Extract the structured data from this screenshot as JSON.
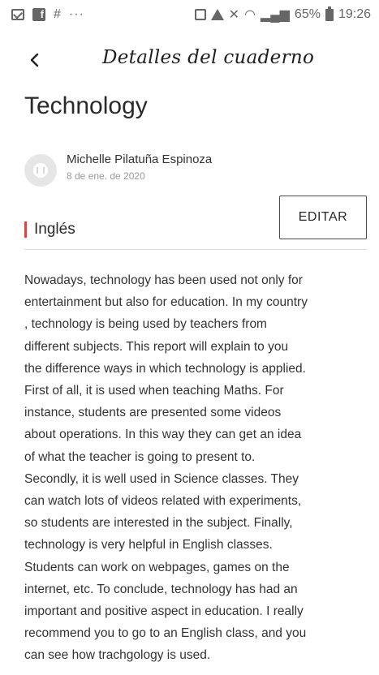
{
  "status_bar": {
    "battery_text": "65%",
    "time": "19:26",
    "more": "···"
  },
  "header": {
    "title": "Detalles del cuaderno",
    "back_icon": "back-arrow-icon"
  },
  "notebook": {
    "title": "Technology",
    "author_name": "Michelle Pilatuña Espinoza",
    "date": "8 de ene. de 2020",
    "subject": "Inglés",
    "edit_label": "EDITAR",
    "accent_color": "#e8413d",
    "body_lines": [
      "Nowadays, technology has been used not only for",
      "entertainment but also for education. In my country",
      ", technology is being used by teachers from",
      "different subjects. This report will explain to you",
      "the difference ways in which technology is applied.",
      "First of all, it is used when teaching Maths. For",
      "instance, students are presented some videos",
      "about operations. In this way they can get an idea",
      "of what the teacher is going to present to.",
      "Secondly, it is well used in Science classes. They",
      "can watch lots of videos related with experiments,",
      "so students are interested in the subject. Finally,",
      "technology is very helpful in English classes.",
      "Students can work on webpages, games on the",
      "internet, etc. To conclude, technology has had an",
      "important and positive aspect in education. I really",
      "recommend you to go to an English class, and you",
      "can see how trachgology is used."
    ]
  }
}
